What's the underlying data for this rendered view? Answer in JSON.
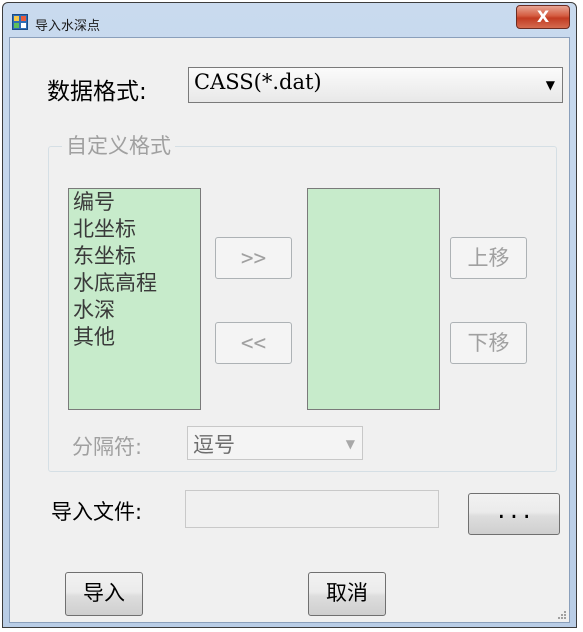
{
  "window": {
    "title": "导入水深点",
    "close_label": "X"
  },
  "format": {
    "label": "数据格式:",
    "selected": "CASS(*.dat)"
  },
  "custom": {
    "title": "自定义格式",
    "available_fields": [
      "编号",
      "北坐标",
      "东坐标",
      "水底高程",
      "水深",
      "其他"
    ],
    "selected_fields": [],
    "add_label": ">>",
    "remove_label": "<<",
    "up_label": "上移",
    "down_label": "下移",
    "separator_label": "分隔符:",
    "separator_value": "逗号"
  },
  "file": {
    "label": "导入文件:",
    "value": "",
    "browse_label": "..."
  },
  "actions": {
    "import_label": "导入",
    "cancel_label": "取消"
  },
  "colors": {
    "list_bg": "#c7ebcb",
    "close_red": "#c23b22"
  }
}
